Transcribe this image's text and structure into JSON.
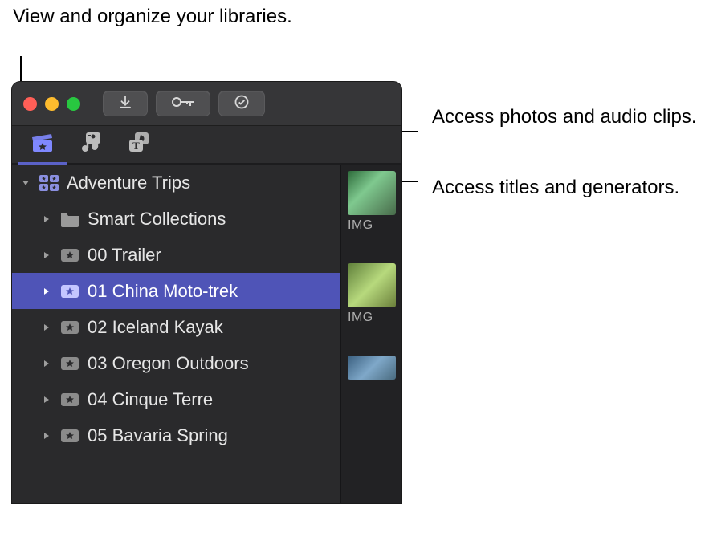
{
  "callouts": {
    "libraries": "View and organize your libraries.",
    "photos_audio": "Access photos and audio clips.",
    "titles_generators": "Access titles and generators."
  },
  "library_name": "Adventure Trips",
  "sidebar_items": [
    {
      "label": "Smart Collections",
      "type": "folder"
    },
    {
      "label": "00 Trailer",
      "type": "event"
    },
    {
      "label": "01 China Moto-trek",
      "type": "event",
      "selected": true
    },
    {
      "label": "02 Iceland Kayak",
      "type": "event"
    },
    {
      "label": "03 Oregon Outdoors",
      "type": "event"
    },
    {
      "label": "04 Cinque Terre",
      "type": "event"
    },
    {
      "label": "05 Bavaria Spring",
      "type": "event"
    }
  ],
  "thumbnails": [
    {
      "label": "IMG"
    },
    {
      "label": "IMG"
    },
    {
      "label": ""
    }
  ]
}
